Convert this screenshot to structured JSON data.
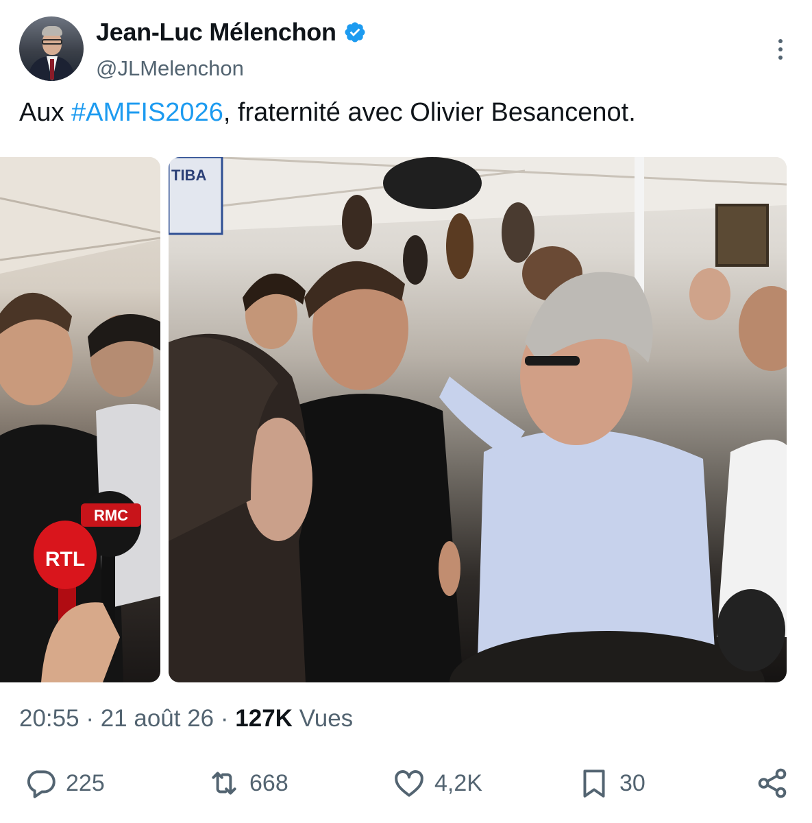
{
  "author": {
    "display_name": "Jean-Luc Mélenchon",
    "handle": "@JLMelenchon",
    "verified": true
  },
  "tweet": {
    "text_before": "Aux ",
    "hashtag": "#AMFIS2026",
    "text_after": ", fraternité avec Olivier Besancenot."
  },
  "media": {
    "left_photo_mic_labels": [
      "RTL",
      "RMC"
    ],
    "right_photo_sign": "TIBA"
  },
  "meta": {
    "time": "20:55",
    "separator": "·",
    "date": "21 août 26",
    "views_count": "127K",
    "views_label": "Vues"
  },
  "actions": {
    "replies": "225",
    "reposts": "668",
    "likes": "4,2K",
    "bookmarks": "30"
  },
  "colors": {
    "accent": "#1d9bf0",
    "text": "#0f1419",
    "secondary": "#536471"
  },
  "icons": [
    "verified-badge-icon",
    "more-icon",
    "reply-icon",
    "retweet-icon",
    "like-icon",
    "bookmark-icon",
    "share-icon"
  ]
}
